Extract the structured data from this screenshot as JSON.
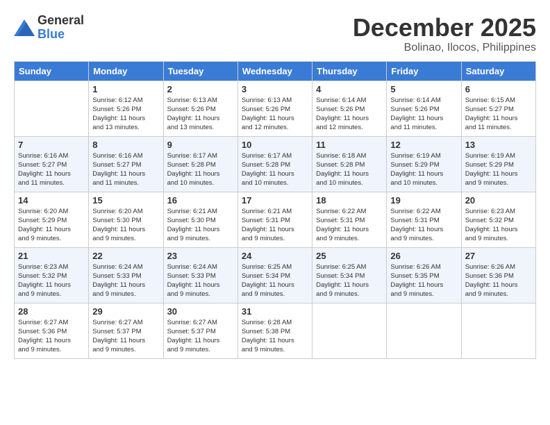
{
  "logo": {
    "general": "General",
    "blue": "Blue"
  },
  "title": {
    "month": "December 2025",
    "location": "Bolinao, Ilocos, Philippines"
  },
  "days_of_week": [
    "Sunday",
    "Monday",
    "Tuesday",
    "Wednesday",
    "Thursday",
    "Friday",
    "Saturday"
  ],
  "weeks": [
    [
      {
        "day": "",
        "info": ""
      },
      {
        "day": "1",
        "info": "Sunrise: 6:12 AM\nSunset: 5:26 PM\nDaylight: 11 hours\nand 13 minutes."
      },
      {
        "day": "2",
        "info": "Sunrise: 6:13 AM\nSunset: 5:26 PM\nDaylight: 11 hours\nand 13 minutes."
      },
      {
        "day": "3",
        "info": "Sunrise: 6:13 AM\nSunset: 5:26 PM\nDaylight: 11 hours\nand 12 minutes."
      },
      {
        "day": "4",
        "info": "Sunrise: 6:14 AM\nSunset: 5:26 PM\nDaylight: 11 hours\nand 12 minutes."
      },
      {
        "day": "5",
        "info": "Sunrise: 6:14 AM\nSunset: 5:26 PM\nDaylight: 11 hours\nand 11 minutes."
      },
      {
        "day": "6",
        "info": "Sunrise: 6:15 AM\nSunset: 5:27 PM\nDaylight: 11 hours\nand 11 minutes."
      }
    ],
    [
      {
        "day": "7",
        "info": "Sunrise: 6:16 AM\nSunset: 5:27 PM\nDaylight: 11 hours\nand 11 minutes."
      },
      {
        "day": "8",
        "info": "Sunrise: 6:16 AM\nSunset: 5:27 PM\nDaylight: 11 hours\nand 11 minutes."
      },
      {
        "day": "9",
        "info": "Sunrise: 6:17 AM\nSunset: 5:28 PM\nDaylight: 11 hours\nand 10 minutes."
      },
      {
        "day": "10",
        "info": "Sunrise: 6:17 AM\nSunset: 5:28 PM\nDaylight: 11 hours\nand 10 minutes."
      },
      {
        "day": "11",
        "info": "Sunrise: 6:18 AM\nSunset: 5:28 PM\nDaylight: 11 hours\nand 10 minutes."
      },
      {
        "day": "12",
        "info": "Sunrise: 6:19 AM\nSunset: 5:29 PM\nDaylight: 11 hours\nand 10 minutes."
      },
      {
        "day": "13",
        "info": "Sunrise: 6:19 AM\nSunset: 5:29 PM\nDaylight: 11 hours\nand 9 minutes."
      }
    ],
    [
      {
        "day": "14",
        "info": "Sunrise: 6:20 AM\nSunset: 5:29 PM\nDaylight: 11 hours\nand 9 minutes."
      },
      {
        "day": "15",
        "info": "Sunrise: 6:20 AM\nSunset: 5:30 PM\nDaylight: 11 hours\nand 9 minutes."
      },
      {
        "day": "16",
        "info": "Sunrise: 6:21 AM\nSunset: 5:30 PM\nDaylight: 11 hours\nand 9 minutes."
      },
      {
        "day": "17",
        "info": "Sunrise: 6:21 AM\nSunset: 5:31 PM\nDaylight: 11 hours\nand 9 minutes."
      },
      {
        "day": "18",
        "info": "Sunrise: 6:22 AM\nSunset: 5:31 PM\nDaylight: 11 hours\nand 9 minutes."
      },
      {
        "day": "19",
        "info": "Sunrise: 6:22 AM\nSunset: 5:31 PM\nDaylight: 11 hours\nand 9 minutes."
      },
      {
        "day": "20",
        "info": "Sunrise: 6:23 AM\nSunset: 5:32 PM\nDaylight: 11 hours\nand 9 minutes."
      }
    ],
    [
      {
        "day": "21",
        "info": "Sunrise: 6:23 AM\nSunset: 5:32 PM\nDaylight: 11 hours\nand 9 minutes."
      },
      {
        "day": "22",
        "info": "Sunrise: 6:24 AM\nSunset: 5:33 PM\nDaylight: 11 hours\nand 9 minutes."
      },
      {
        "day": "23",
        "info": "Sunrise: 6:24 AM\nSunset: 5:33 PM\nDaylight: 11 hours\nand 9 minutes."
      },
      {
        "day": "24",
        "info": "Sunrise: 6:25 AM\nSunset: 5:34 PM\nDaylight: 11 hours\nand 9 minutes."
      },
      {
        "day": "25",
        "info": "Sunrise: 6:25 AM\nSunset: 5:34 PM\nDaylight: 11 hours\nand 9 minutes."
      },
      {
        "day": "26",
        "info": "Sunrise: 6:26 AM\nSunset: 5:35 PM\nDaylight: 11 hours\nand 9 minutes."
      },
      {
        "day": "27",
        "info": "Sunrise: 6:26 AM\nSunset: 5:36 PM\nDaylight: 11 hours\nand 9 minutes."
      }
    ],
    [
      {
        "day": "28",
        "info": "Sunrise: 6:27 AM\nSunset: 5:36 PM\nDaylight: 11 hours\nand 9 minutes."
      },
      {
        "day": "29",
        "info": "Sunrise: 6:27 AM\nSunset: 5:37 PM\nDaylight: 11 hours\nand 9 minutes."
      },
      {
        "day": "30",
        "info": "Sunrise: 6:27 AM\nSunset: 5:37 PM\nDaylight: 11 hours\nand 9 minutes."
      },
      {
        "day": "31",
        "info": "Sunrise: 6:28 AM\nSunset: 5:38 PM\nDaylight: 11 hours\nand 9 minutes."
      },
      {
        "day": "",
        "info": ""
      },
      {
        "day": "",
        "info": ""
      },
      {
        "day": "",
        "info": ""
      }
    ]
  ]
}
